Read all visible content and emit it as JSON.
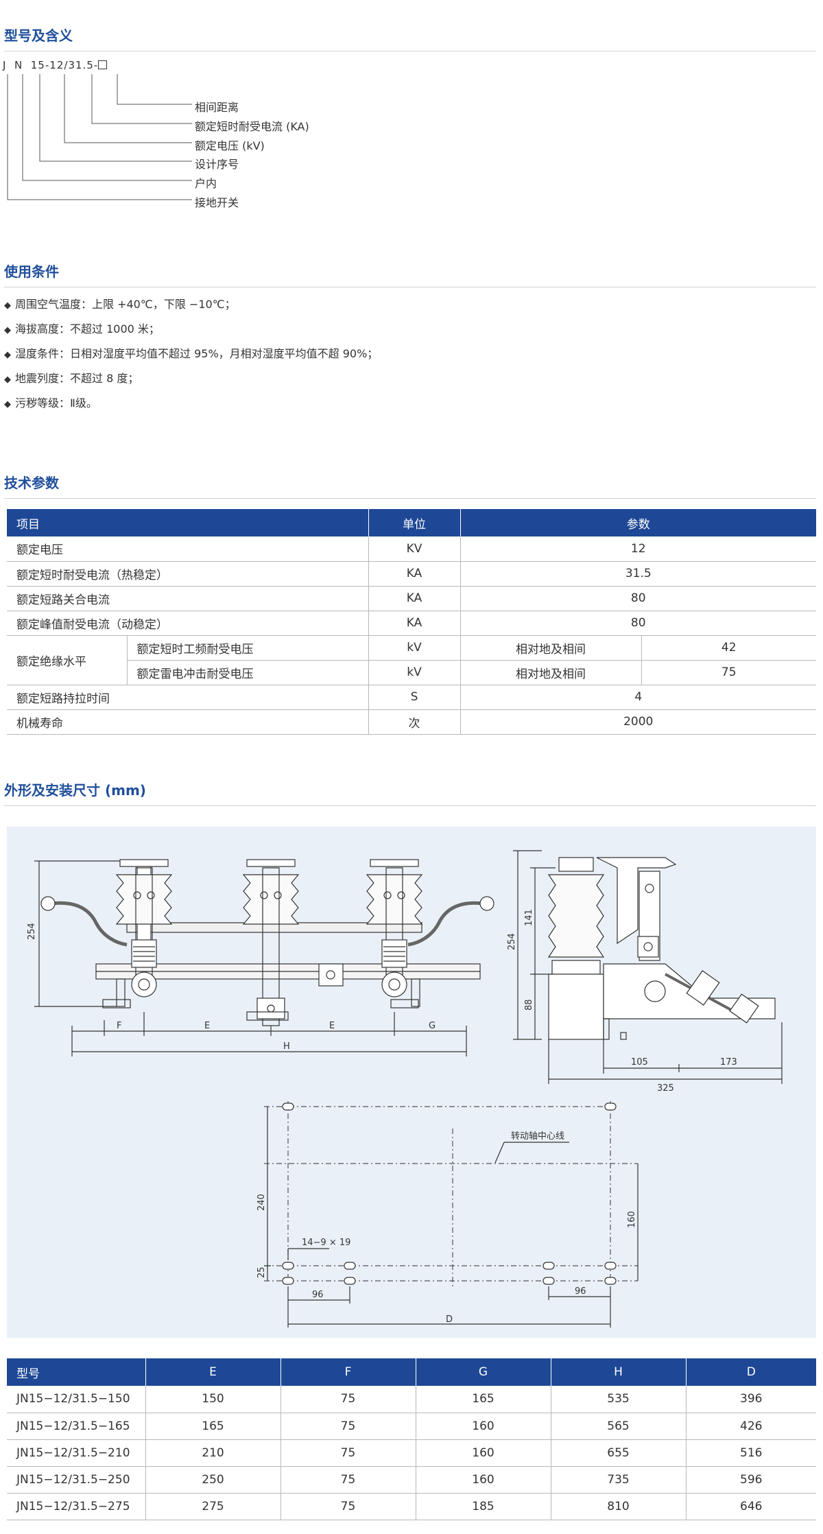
{
  "section1": {
    "title": "型号及含义",
    "code": {
      "p1": "J",
      "p2": "N",
      "p3": "15",
      "p4": "12",
      "p5": "31.5"
    },
    "meanings": [
      "相间距离",
      "额定短时耐受电流 (KA)",
      "额定电压 (kV)",
      "设计序号",
      "户内",
      "接地开关"
    ]
  },
  "section2": {
    "title": "使用条件",
    "items": [
      "周围空气温度：上限 +40℃，下限 −10℃；",
      "海拔高度：不超过 1000 米；",
      "湿度条件：日相对湿度平均值不超过 95%，月相对湿度平均值不超 90%；",
      "地震列度：不超过 8 度；",
      "污秽等级：Ⅱ级。"
    ]
  },
  "section3": {
    "title": "技术参数",
    "headers": {
      "item": "项目",
      "unit": "单位",
      "param": "参数"
    },
    "rows": [
      {
        "item": "额定电压",
        "unit": "KV",
        "value": "12"
      },
      {
        "item": "额定短时耐受电流（热稳定）",
        "unit": "KA",
        "value": "31.5"
      },
      {
        "item": "额定短路关合电流",
        "unit": "KA",
        "value": "80"
      },
      {
        "item": "额定峰值耐受电流（动稳定）",
        "unit": "KA",
        "value": "80"
      }
    ],
    "insulation": {
      "label": "额定绝缘水平",
      "rows": [
        {
          "sub": "额定短时工频耐受电压",
          "unit": "kV",
          "cond": "相对地及相间",
          "value": "42"
        },
        {
          "sub": "额定雷电冲击耐受电压",
          "unit": "kV",
          "cond": "相对地及相间",
          "value": "75"
        }
      ]
    },
    "rows2": [
      {
        "item": "额定短路持拉时间",
        "unit": "S",
        "value": "4"
      },
      {
        "item": "机械寿命",
        "unit": "次",
        "value": "2000"
      }
    ]
  },
  "section4": {
    "title": "外形及安装尺寸 (mm)",
    "drawing": {
      "front": {
        "height": "254",
        "labels": [
          "F",
          "E",
          "E",
          "G",
          "H"
        ]
      },
      "side": {
        "h_total": "254",
        "h_upper": "141",
        "h_lower": "88",
        "w1": "105",
        "w2": "173",
        "w_total": "325"
      },
      "plan": {
        "axis_label": "转动轴中心线",
        "hole": "14−9 × 19",
        "h240": "240",
        "h25": "25",
        "h160": "160",
        "w96a": "96",
        "w96b": "96",
        "d": "D"
      }
    },
    "table": {
      "headers": [
        "型号",
        "E",
        "F",
        "G",
        "H",
        "D"
      ],
      "rows": [
        [
          "JN15−12/31.5−150",
          "150",
          "75",
          "165",
          "535",
          "396"
        ],
        [
          "JN15−12/31.5−165",
          "165",
          "75",
          "160",
          "565",
          "426"
        ],
        [
          "JN15−12/31.5−210",
          "210",
          "75",
          "160",
          "655",
          "516"
        ],
        [
          "JN15−12/31.5−250",
          "250",
          "75",
          "160",
          "735",
          "596"
        ],
        [
          "JN15−12/31.5−275",
          "275",
          "75",
          "185",
          "810",
          "646"
        ]
      ]
    }
  }
}
